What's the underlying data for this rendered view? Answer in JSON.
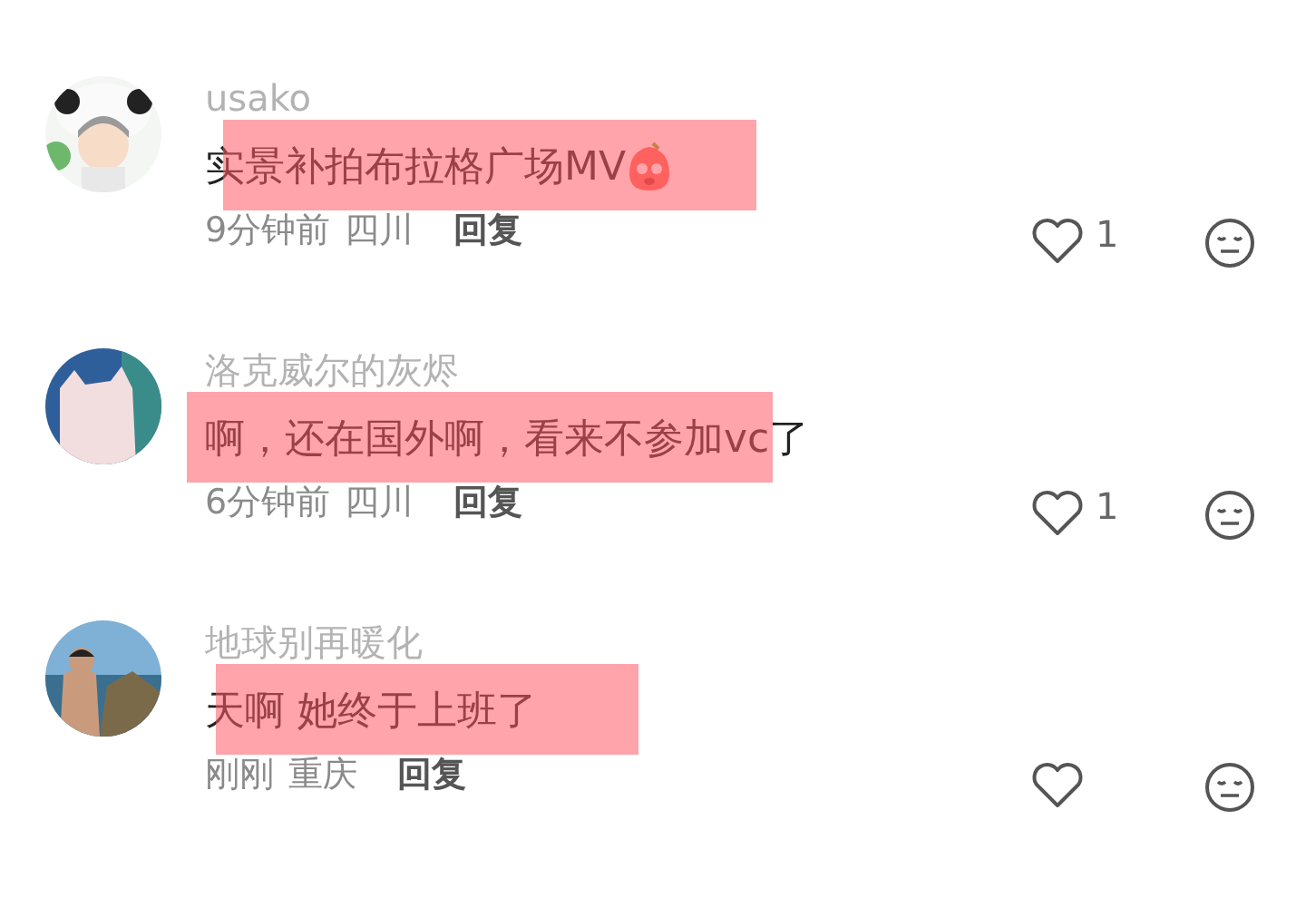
{
  "comments": [
    {
      "author": "usako",
      "text": "实景补拍布拉格广场MV",
      "emoji": true,
      "highlighted": true,
      "time": "9分钟前",
      "location": "四川",
      "reply": "回复",
      "likes": "1",
      "liked": false
    },
    {
      "author": "洛克威尔的灰烬",
      "text": "啊，还在国外啊，看来不参加vc了",
      "emoji": false,
      "highlighted": true,
      "time": "6分钟前",
      "location": "四川",
      "reply": "回复",
      "likes": "1",
      "liked": false
    },
    {
      "author": "地球别再暖化",
      "text": "天啊 她终于上班了",
      "emoji": false,
      "highlighted": true,
      "time": "刚刚",
      "location": "重庆",
      "reply": "回复",
      "liked": false
    }
  ]
}
